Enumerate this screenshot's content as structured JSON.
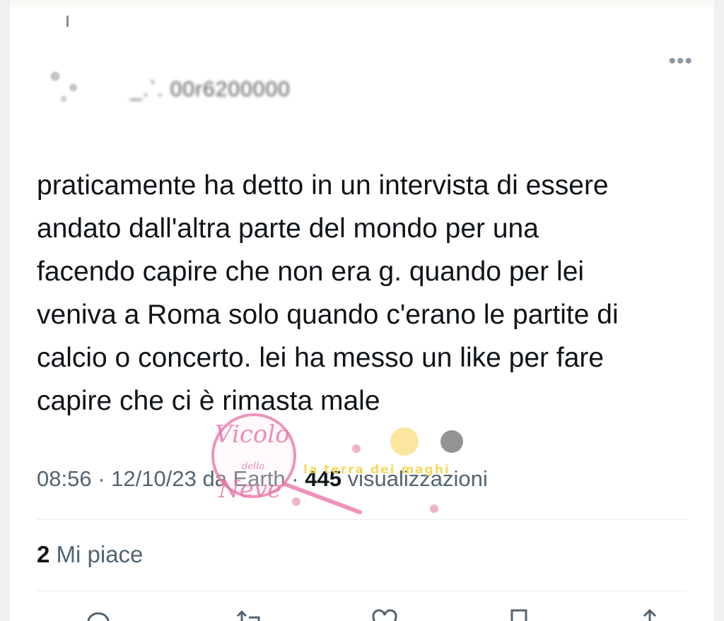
{
  "tweet": {
    "author_handle": "_.`. 00r6200000",
    "more_icon": "more-horizontal-icon",
    "text": "praticamente ha detto in un intervista di essere\nandato dall'altra parte del mondo per una\nfacendo capire che non era g. quando per lei\nveniva a Roma solo quando c'erano le partite di\ncalcio o concerto. lei ha messo un like per fare\ncapire che ci è rimasta male",
    "time": "08:56",
    "separator": "·",
    "date": "12/10/23",
    "source": "da Earth",
    "views_count": "445",
    "views_label": "visualizzazioni",
    "likes_count": "2",
    "likes_label": "Mi piace"
  },
  "watermark": {
    "line1": "Vicolo",
    "line2": "della",
    "line3": "Neve",
    "banner": "la terra dei maghi",
    "color": "#e978aa"
  },
  "actions": [
    "reply-icon",
    "retweet-icon",
    "like-icon",
    "bookmark-icon",
    "share-icon"
  ],
  "colors": {
    "text": "#0f1419",
    "muted": "#536471",
    "divider": "#e6ecf0"
  }
}
